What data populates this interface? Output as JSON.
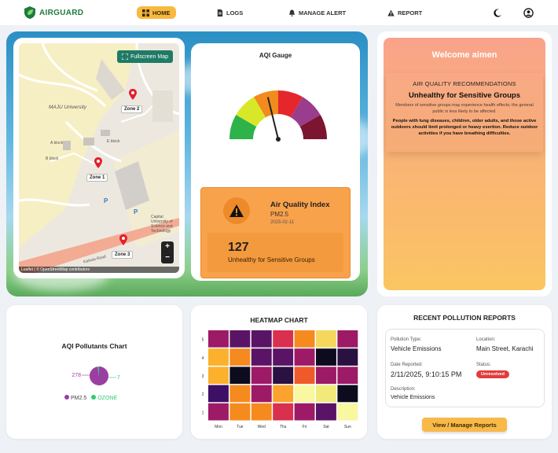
{
  "nav": {
    "brand": "AIRGUARD",
    "items": [
      {
        "label": "HOME",
        "icon": "grid-icon",
        "active": true
      },
      {
        "label": "LOGS",
        "icon": "document-icon",
        "active": false
      },
      {
        "label": "MANAGE ALERT",
        "icon": "bell-icon",
        "active": false
      },
      {
        "label": "REPORT",
        "icon": "warning-icon",
        "active": false
      }
    ],
    "theme_icon": "moon-icon",
    "profile_icon": "user-circle-icon"
  },
  "map": {
    "fullscreen_label": "Fullscreen Map",
    "zones": [
      "Zone 2",
      "Zone 1",
      "Zone 3"
    ],
    "places": [
      "MAJU University",
      "A block",
      "B block",
      "E block"
    ],
    "campus_label": "Capital University of Science and Technology",
    "road_label": "Kahuta Road",
    "parking": [
      "P",
      "P"
    ],
    "zoom_in": "+",
    "zoom_out": "−",
    "attribution": "Leaflet | © OpenStreetMap contributors"
  },
  "gauge": {
    "title": "AQI Gauge",
    "value": 127,
    "max": 300,
    "segments": [
      "#2db34a",
      "#d8e829",
      "#f28a1c",
      "#e5262b",
      "#9a3d8c",
      "#7b1530"
    ]
  },
  "aqi": {
    "title": "Air Quality Index",
    "pollutant": "PM2.5",
    "date": "2025-02-11",
    "value": "127",
    "status": "Unhealthy for Sensitive Groups"
  },
  "welcome": {
    "title": "Welcome aimen",
    "reco_heading": "AIR QUALITY RECOMMENDATIONS",
    "level": "Unhealthy for Sensitive Groups",
    "description": "Members of sensitive groups may experience health effects; the general public is less likely to be affected.",
    "advice": "People with lung diseases, children, older adults, and those active outdoors should limit prolonged or heavy exertion. Reduce outdoor activities if you have breathing difficulties."
  },
  "pollutants_chart": {
    "title": "AQI Pollutants Chart",
    "legend": [
      "PM2.5",
      "OZONE"
    ]
  },
  "heatmap": {
    "title": "HEATMAP CHART"
  },
  "chart_data": [
    {
      "type": "pie",
      "title": "AQI Pollutants Chart",
      "categories": [
        "PM2.5",
        "OZONE"
      ],
      "values": [
        278,
        7
      ],
      "colors": [
        "#9b3ea2",
        "#2ecc71"
      ]
    },
    {
      "type": "heatmap",
      "title": "HEATMAP CHART",
      "x": [
        "Mon",
        "Tue",
        "Wed",
        "Thu",
        "Fri",
        "Sat",
        "Sun"
      ],
      "y": [
        5,
        4,
        3,
        2,
        1
      ],
      "colors": [
        [
          "#9c1a66",
          "#5a1465",
          "#5a1465",
          "#d9304f",
          "#f58a1f",
          "#f4d75c",
          "#9c1a66"
        ],
        [
          "#fbb12c",
          "#f58a1f",
          "#5a1465",
          "#5a1465",
          "#9c1a66",
          "#0c0c1e",
          "#2a1142"
        ],
        [
          "#fbb12c",
          "#0c0c1e",
          "#9c1a66",
          "#2a1142",
          "#f05a2a",
          "#9c1a66",
          "#9c1a66"
        ],
        [
          "#3d1066",
          "#f58a1f",
          "#9c1a66",
          "#fba32c",
          "#f9f7a0",
          "#f1ea7a",
          "#0c0c1e"
        ],
        [
          "#9c1a66",
          "#f58a1f",
          "#f58a1f",
          "#d9304f",
          "#9c1a66",
          "#5a1465",
          "#f9f7a0"
        ]
      ]
    }
  ],
  "reports": {
    "title": "RECENT POLLUTION REPORTS",
    "type_label": "Pollution Type:",
    "type_value": "Vehicle Emissions",
    "location_label": "Location:",
    "location_value": "Main Street, Karachi",
    "date_label": "Date Reported:",
    "date_value": "2/11/2025, 9:10:15 PM",
    "status_label": "Status:",
    "status_value": "Unresolved",
    "desc_label": "Description:",
    "desc_value": "Vehicle Emissions",
    "button": "View / Manage Reports"
  }
}
